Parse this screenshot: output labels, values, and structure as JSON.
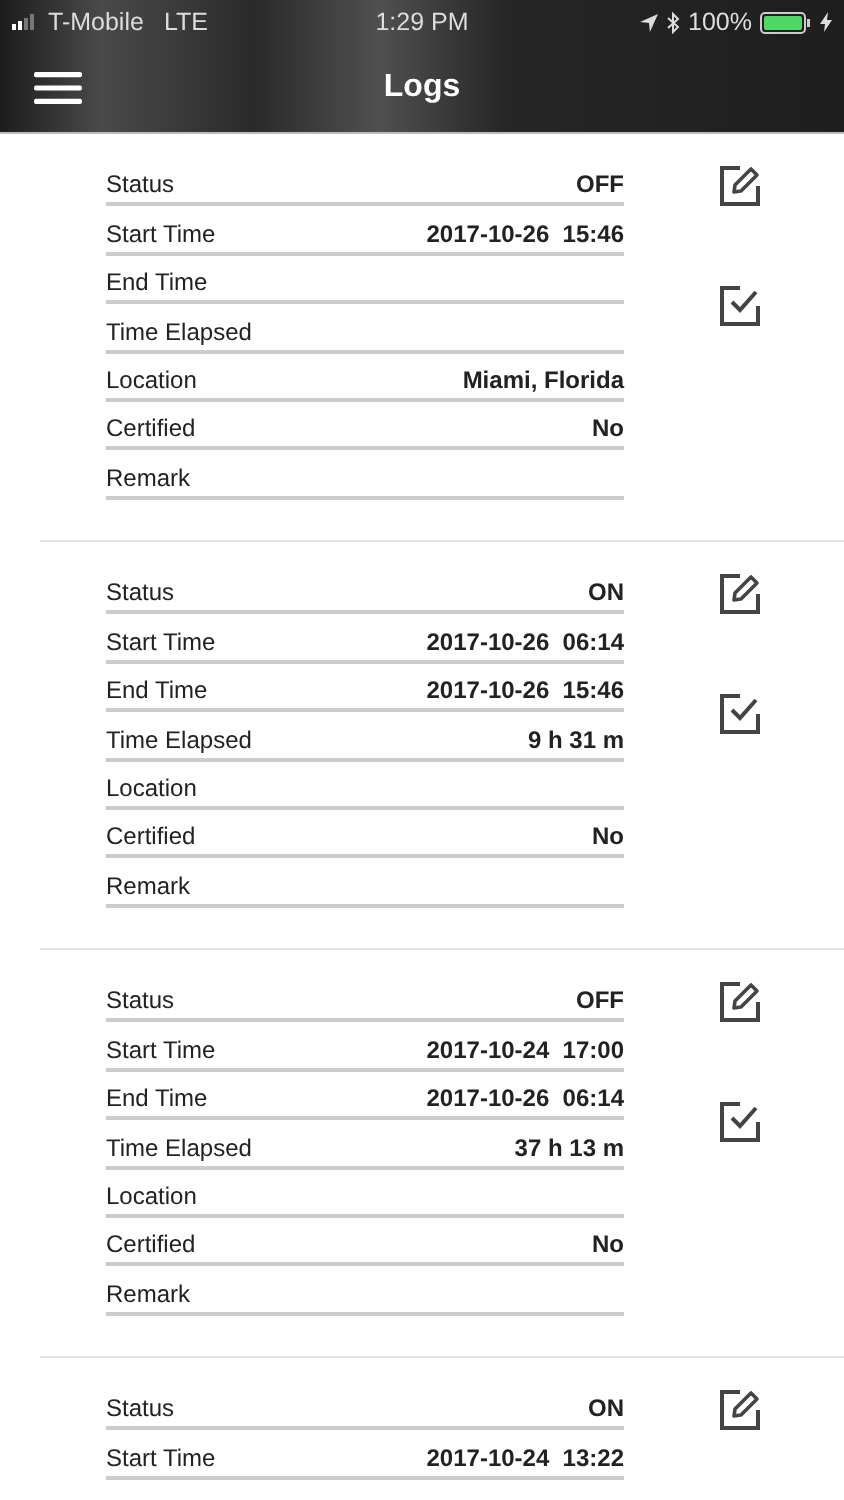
{
  "status_bar": {
    "carrier": "T-Mobile",
    "network": "LTE",
    "time": "1:29 PM",
    "battery": "100%"
  },
  "header": {
    "title": "Logs"
  },
  "logs": [
    {
      "rows": [
        {
          "label": "Status",
          "value": "OFF"
        },
        {
          "label": "Start Time",
          "value": "2017-10-26  15:46"
        },
        {
          "label": "End Time"
        },
        {
          "label": "Time Elapsed"
        },
        {
          "label": "Location",
          "value": "Miami, Florida"
        },
        {
          "label": "Certified",
          "value": "No"
        },
        {
          "label": "Remark"
        }
      ]
    },
    {
      "rows": [
        {
          "label": "Status",
          "value": "ON"
        },
        {
          "label": "Start Time",
          "value": "2017-10-26  06:14"
        },
        {
          "label": "End Time",
          "value": "2017-10-26  15:46"
        },
        {
          "label": "Time Elapsed",
          "value": "9 h 31 m"
        },
        {
          "label": "Location"
        },
        {
          "label": "Certified",
          "value": "No"
        },
        {
          "label": "Remark"
        }
      ]
    },
    {
      "rows": [
        {
          "label": "Status",
          "value": "OFF"
        },
        {
          "label": "Start Time",
          "value": "2017-10-24  17:00"
        },
        {
          "label": "End Time",
          "value": "2017-10-26  06:14"
        },
        {
          "label": "Time Elapsed",
          "value": "37 h 13 m"
        },
        {
          "label": "Location"
        },
        {
          "label": "Certified",
          "value": "No"
        },
        {
          "label": "Remark"
        }
      ]
    },
    {
      "rows": [
        {
          "label": "Status",
          "value": "ON"
        },
        {
          "label": "Start Time",
          "value": "2017-10-24  13:22"
        }
      ]
    }
  ]
}
